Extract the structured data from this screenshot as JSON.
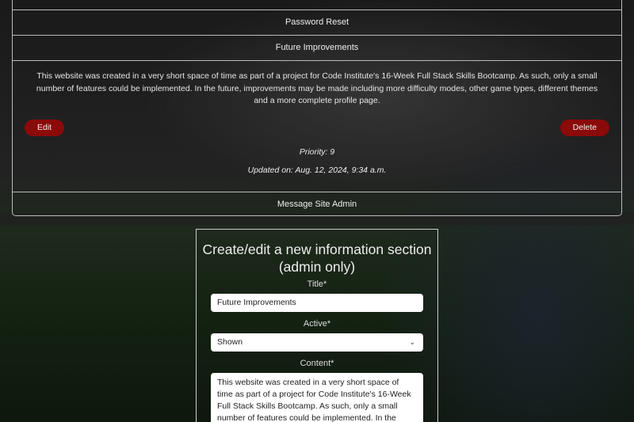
{
  "accordion": {
    "items": [
      {
        "label": "Password Reset"
      },
      {
        "label": "Future Improvements"
      },
      {
        "label": "Message Site Admin"
      }
    ],
    "expanded": {
      "content": "This website was created in a very short space of time as part of a project for Code Institute's 16-Week Full Stack Skills Bootcamp. As such, only a small number of features could be implemented. In the future, improvements may be made including more difficulty modes, other game types, different themes and a more complete profile page.",
      "edit_label": "Edit",
      "delete_label": "Delete",
      "priority": "Priority: 9",
      "updated": "Updated on: Aug. 12, 2024, 9:34 a.m."
    }
  },
  "form": {
    "heading": "Create/edit a new information section (admin only)",
    "title_label": "Title*",
    "title_value": "Future Improvements",
    "active_label": "Active*",
    "active_value": "Shown",
    "content_label": "Content*",
    "content_value": "This website was created in a very short space of time as part of a project for Code Institute's 16-Week Full Stack Skills Bootcamp. As such, only a small number of features could be implemented. In the future, improvements may be made including more difficulty modes, other game types, different themes and a more complete profile page."
  },
  "colors": {
    "button": "#8b0a0a"
  }
}
